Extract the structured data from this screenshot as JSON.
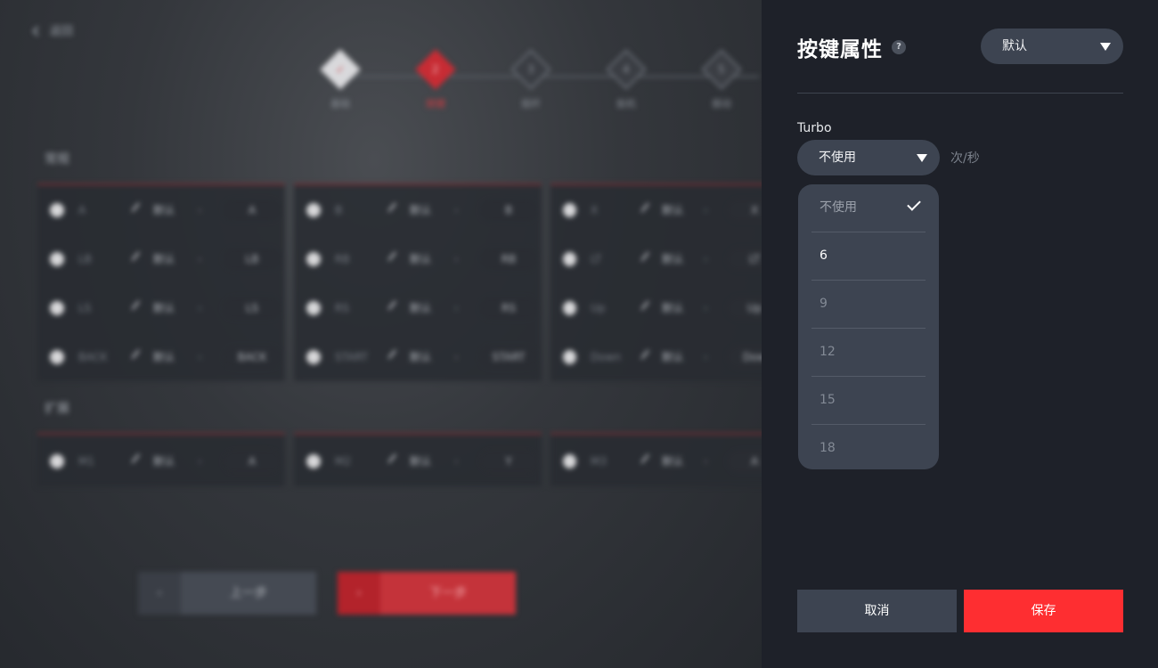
{
  "background": {
    "back_label": "返回",
    "steps": [
      {
        "label": "基础",
        "num": "✓"
      },
      {
        "label": "按键",
        "num": "2"
      },
      {
        "label": "摇杆",
        "num": "3"
      },
      {
        "label": "扳机",
        "num": "4"
      },
      {
        "label": "振动",
        "num": "5"
      }
    ],
    "section_basic": "常规",
    "section_ext": "扩展",
    "default_text": "默认",
    "columns": [
      {
        "rows": [
          {
            "name": "A",
            "value": "A"
          },
          {
            "name": "LB",
            "value": "LB"
          },
          {
            "name": "LS",
            "value": "LS"
          },
          {
            "name": "BACK",
            "value": "BACK"
          }
        ]
      },
      {
        "rows": [
          {
            "name": "B",
            "value": "B"
          },
          {
            "name": "RB",
            "value": "RB"
          },
          {
            "name": "RS",
            "value": "RS"
          },
          {
            "name": "START",
            "value": "START"
          }
        ]
      },
      {
        "rows": [
          {
            "name": "X",
            "value": "X"
          },
          {
            "name": "LT",
            "value": "LT"
          },
          {
            "name": "Up",
            "value": "Up"
          },
          {
            "name": "Down",
            "value": "Dow"
          }
        ]
      }
    ],
    "ext_rows": [
      {
        "name": "M1",
        "value": "A"
      },
      {
        "name": "M2",
        "value": "Y"
      },
      {
        "name": "M3",
        "value": "A"
      }
    ],
    "prev_label": "上一步",
    "next_label": "下一步"
  },
  "drawer": {
    "title": "按键属性",
    "help_glyph": "?",
    "profile_select": "默认",
    "turbo_label": "Turbo",
    "turbo_select": "不使用",
    "unit": "次/秒",
    "options": [
      "不使用",
      "6",
      "9",
      "12",
      "15",
      "18"
    ],
    "cancel_label": "取消",
    "save_label": "保存"
  }
}
